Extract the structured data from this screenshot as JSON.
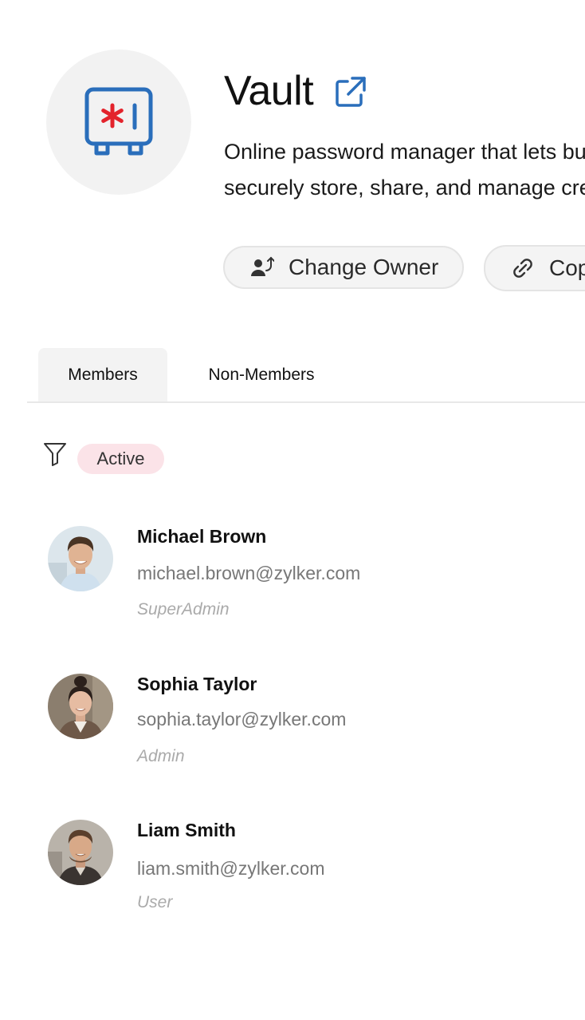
{
  "app": {
    "title": "Vault",
    "description_line1": "Online password manager that lets bu",
    "description_line2": "securely store, share, and manage cre",
    "icon": "vault-safe-icon",
    "brand_blue": "#2a6ebb",
    "brand_red": "#e3232c"
  },
  "actions": {
    "change_owner_label": "Change Owner",
    "copy_label": "Cop"
  },
  "tabs": [
    {
      "label": "Members",
      "selected": true
    },
    {
      "label": "Non-Members",
      "selected": false
    }
  ],
  "filter": {
    "chip_label": "Active",
    "chip_color": "#fbe3e8"
  },
  "members": [
    {
      "name": "Michael Brown",
      "email": "michael.brown@zylker.com",
      "role": "SuperAdmin"
    },
    {
      "name": "Sophia Taylor",
      "email": "sophia.taylor@zylker.com",
      "role": "Admin"
    },
    {
      "name": "Liam Smith",
      "email": "liam.smith@zylker.com",
      "role": "User"
    }
  ]
}
